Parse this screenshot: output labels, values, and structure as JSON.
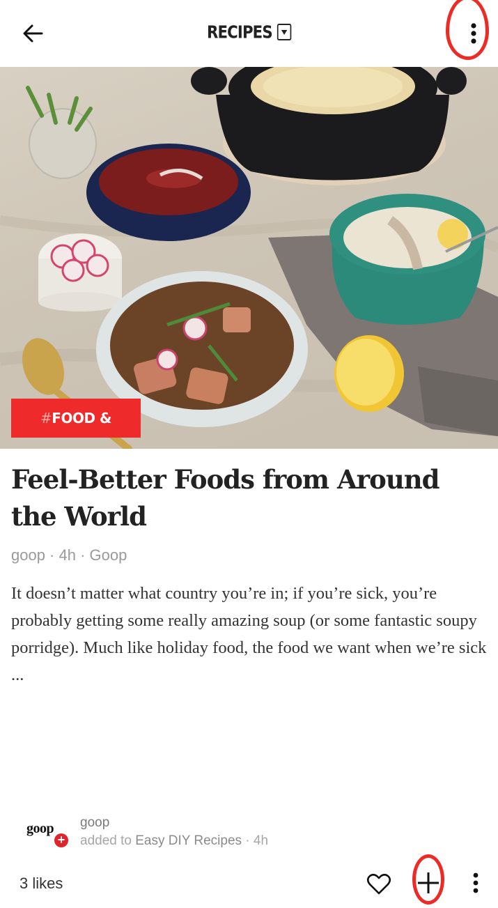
{
  "header": {
    "section_title": "RECIPES",
    "back_icon": "arrow-left-icon",
    "dropdown_icon": "dropdown-box-icon",
    "more_icon": "more-vertical-icon"
  },
  "article": {
    "topic_tag_hash": "#",
    "topic_tag": "FOOD & DINING",
    "title": "Feel-Better Foods from Around the World",
    "meta": "goop · 4h · Goop",
    "excerpt": "It doesn’t matter what country you’re in; if you’re sick, you’re probably getting some really amazing soup (or some fantastic soupy porridge). Much like holiday food, the food we want when we’re sick ...",
    "image_description": "Table spread of soups and porridges: dark clay pot with rice, navy bowl of red soup with pomegranate, teal bowl of chicken porridge with lemon, white bowl of salmon stew, radishes, greens, lemon half, gold spoon"
  },
  "source": {
    "logo_text": "goop",
    "name": "goop",
    "added_prefix": "added to",
    "magazine": "Easy DIY Recipes",
    "age": "· 4h",
    "follow_icon": "plus-circle-icon"
  },
  "footer": {
    "likes": "3 likes",
    "like_icon": "heart-outline-icon",
    "add_icon": "plus-icon",
    "more_icon": "more-vertical-icon"
  },
  "colors": {
    "accent_red": "#ee2a2a",
    "annotation_red": "#ee2a24",
    "text_dark": "#222222",
    "text_muted": "#9a9a9a"
  }
}
